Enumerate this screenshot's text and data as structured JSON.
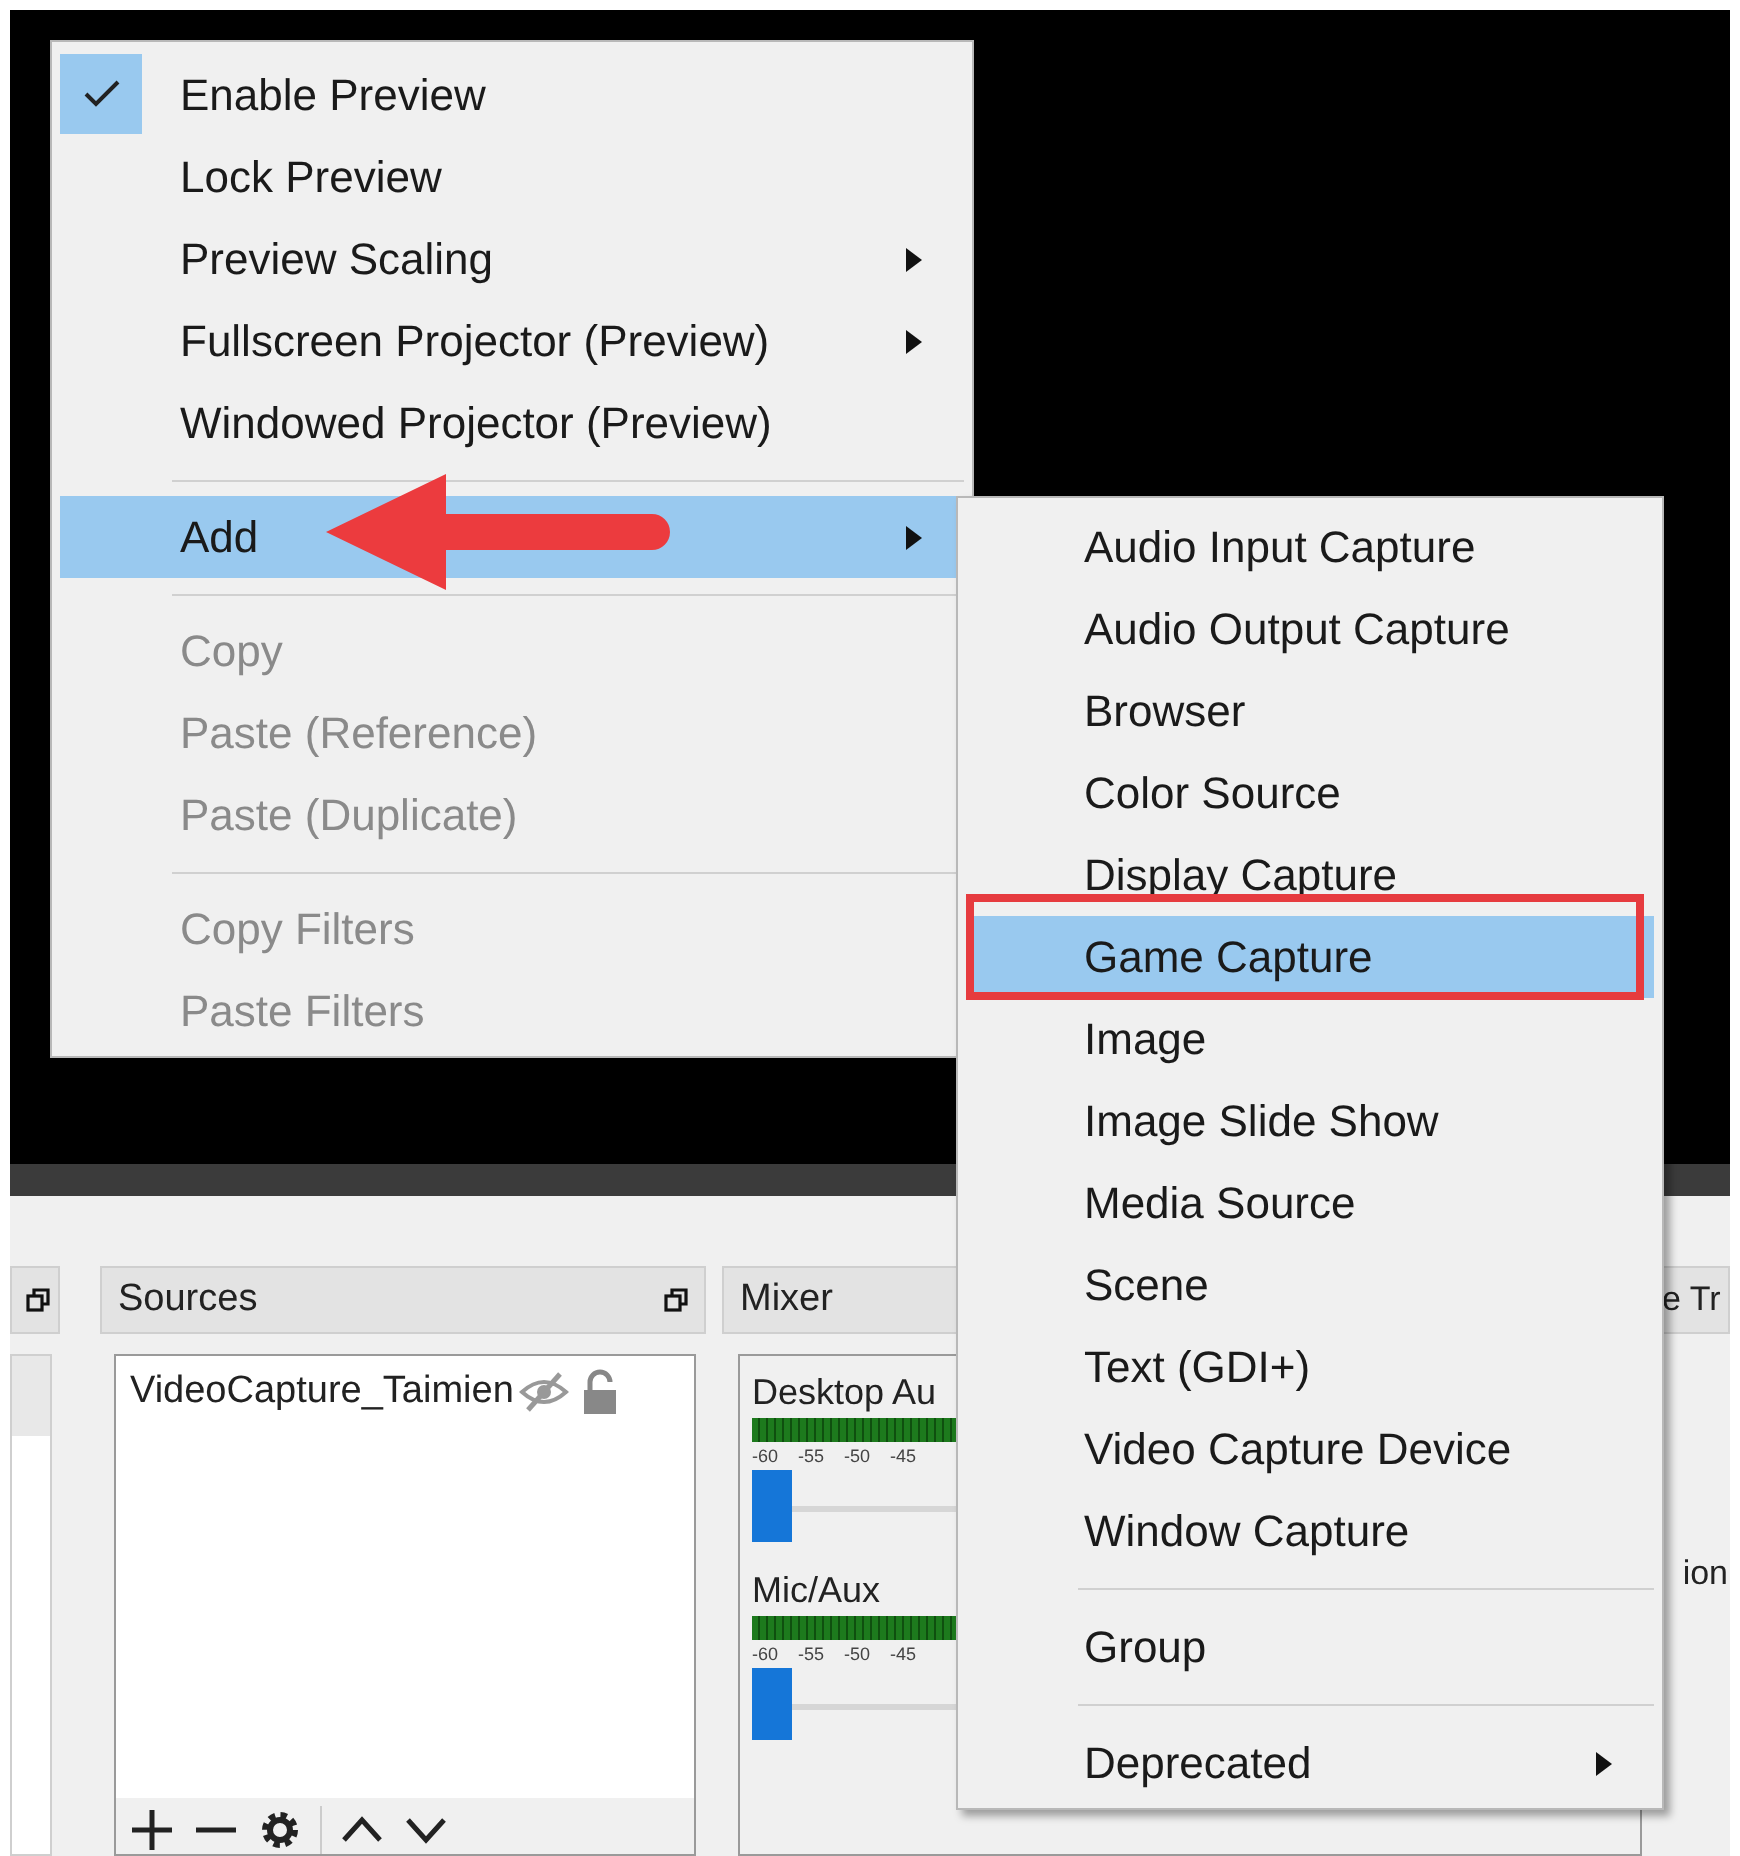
{
  "context_menu": {
    "items": [
      {
        "kind": "item",
        "label": "Enable Preview",
        "checked": true,
        "selected": false,
        "disabled": false,
        "has_submenu": false
      },
      {
        "kind": "item",
        "label": "Lock Preview",
        "checked": false,
        "selected": false,
        "disabled": false,
        "has_submenu": false
      },
      {
        "kind": "item",
        "label": "Preview Scaling",
        "checked": false,
        "selected": false,
        "disabled": false,
        "has_submenu": true
      },
      {
        "kind": "item",
        "label": "Fullscreen Projector (Preview)",
        "checked": false,
        "selected": false,
        "disabled": false,
        "has_submenu": true
      },
      {
        "kind": "item",
        "label": "Windowed Projector (Preview)",
        "checked": false,
        "selected": false,
        "disabled": false,
        "has_submenu": false
      },
      {
        "kind": "separator"
      },
      {
        "kind": "item",
        "label": "Add",
        "checked": false,
        "selected": true,
        "disabled": false,
        "has_submenu": true
      },
      {
        "kind": "separator"
      },
      {
        "kind": "item",
        "label": "Copy",
        "checked": false,
        "selected": false,
        "disabled": true,
        "has_submenu": false
      },
      {
        "kind": "item",
        "label": "Paste (Reference)",
        "checked": false,
        "selected": false,
        "disabled": true,
        "has_submenu": false
      },
      {
        "kind": "item",
        "label": "Paste (Duplicate)",
        "checked": false,
        "selected": false,
        "disabled": true,
        "has_submenu": false
      },
      {
        "kind": "separator"
      },
      {
        "kind": "item",
        "label": "Copy Filters",
        "checked": false,
        "selected": false,
        "disabled": true,
        "has_submenu": false
      },
      {
        "kind": "item",
        "label": "Paste Filters",
        "checked": false,
        "selected": false,
        "disabled": true,
        "has_submenu": false
      }
    ]
  },
  "add_submenu": {
    "items": [
      {
        "kind": "item",
        "label": "Audio Input Capture",
        "selected": false,
        "has_submenu": false
      },
      {
        "kind": "item",
        "label": "Audio Output Capture",
        "selected": false,
        "has_submenu": false
      },
      {
        "kind": "item",
        "label": "Browser",
        "selected": false,
        "has_submenu": false
      },
      {
        "kind": "item",
        "label": "Color Source",
        "selected": false,
        "has_submenu": false
      },
      {
        "kind": "item",
        "label": "Display Capture",
        "selected": false,
        "has_submenu": false
      },
      {
        "kind": "item",
        "label": "Game Capture",
        "selected": true,
        "has_submenu": false
      },
      {
        "kind": "item",
        "label": "Image",
        "selected": false,
        "has_submenu": false
      },
      {
        "kind": "item",
        "label": "Image Slide Show",
        "selected": false,
        "has_submenu": false
      },
      {
        "kind": "item",
        "label": "Media Source",
        "selected": false,
        "has_submenu": false
      },
      {
        "kind": "item",
        "label": "Scene",
        "selected": false,
        "has_submenu": false
      },
      {
        "kind": "item",
        "label": "Text (GDI+)",
        "selected": false,
        "has_submenu": false
      },
      {
        "kind": "item",
        "label": "Video Capture Device",
        "selected": false,
        "has_submenu": false
      },
      {
        "kind": "item",
        "label": "Window Capture",
        "selected": false,
        "has_submenu": false
      },
      {
        "kind": "separator"
      },
      {
        "kind": "item",
        "label": "Group",
        "selected": false,
        "has_submenu": false
      },
      {
        "kind": "separator"
      },
      {
        "kind": "item",
        "label": "Deprecated",
        "selected": false,
        "has_submenu": true
      }
    ]
  },
  "sources": {
    "title": "Sources",
    "items": [
      {
        "name": "VideoCapture_Taimien",
        "visible": false,
        "locked": false
      }
    ]
  },
  "mixer": {
    "title": "Mixer",
    "channels": [
      {
        "name": "Desktop Au",
        "ticks": [
          "-60",
          "-55",
          "-50",
          "-45"
        ],
        "level": 0
      },
      {
        "name": "Mic/Aux",
        "ticks": [
          "-60",
          "-55",
          "-50",
          "-45"
        ],
        "level": 0
      }
    ]
  },
  "right_dock": {
    "title": "e Tr",
    "text": "ion"
  }
}
